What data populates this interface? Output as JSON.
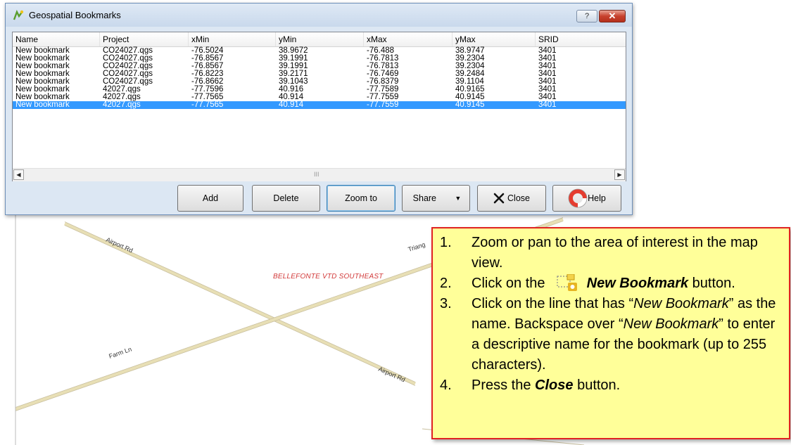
{
  "window": {
    "title": "Geospatial Bookmarks",
    "help_button": "?",
    "close_button": "✕"
  },
  "table": {
    "columns": [
      "Name",
      "Project",
      "xMin",
      "yMin",
      "xMax",
      "yMax",
      "SRID"
    ],
    "rows": [
      [
        "New bookmark",
        "CO24027.qgs",
        "-76.5024",
        "38.9672",
        "-76.488",
        "38.9747",
        "3401"
      ],
      [
        "New bookmark",
        "CO24027.qgs",
        "-76.8567",
        "39.1991",
        "-76.7813",
        "39.2304",
        "3401"
      ],
      [
        "New bookmark",
        "CO24027.qgs",
        "-76.8567",
        "39.1991",
        "-76.7813",
        "39.2304",
        "3401"
      ],
      [
        "New bookmark",
        "CO24027.qgs",
        "-76.8223",
        "39.2171",
        "-76.7469",
        "39.2484",
        "3401"
      ],
      [
        "New bookmark",
        "CO24027.qgs",
        "-76.8662",
        "39.1043",
        "-76.8379",
        "39.1104",
        "3401"
      ],
      [
        "New bookmark",
        "42027.qgs",
        "-77.7596",
        "40.916",
        "-77.7589",
        "40.9165",
        "3401"
      ],
      [
        "New bookmark",
        "42027.qgs",
        "-77.7565",
        "40.914",
        "-77.7559",
        "40.9145",
        "3401"
      ],
      [
        "New bookmark",
        "42027.qgs",
        "-77.7565",
        "40.914",
        "-77.7559",
        "40.9145",
        "3401"
      ]
    ],
    "selected_row": 7,
    "scroll_grip": "III"
  },
  "buttons": {
    "add": "Add",
    "delete": "Delete",
    "zoom_to": "Zoom to",
    "share": "Share",
    "close": "Close",
    "help": "Help"
  },
  "icons": {
    "title": "bookmark-star-icon",
    "close": "x-mark-icon",
    "help": "lifebuoy-icon",
    "share_arrow": "dropdown-arrow-icon",
    "new_bookmark": "new-bookmark-icon"
  },
  "colors": {
    "selection": "#3399ff",
    "callout_bg": "#ffff99",
    "callout_border": "#e02222",
    "district_label": "#d23a3a"
  },
  "map": {
    "road_labels": {
      "airport_rd_top": "Airport Rd",
      "triangle": "Triang",
      "farm_ln": "Farm Ln",
      "airport_rd_bottom": "Airport Rd"
    },
    "district_label": "BELLEFONTE VTD SOUTHEAST"
  },
  "callout": {
    "step1_num": "1.",
    "step1_text": "Zoom or pan to the area of interest in the map view.",
    "step2_num": "2.",
    "step2_prefix": "Click on the",
    "step2_bold": "New Bookmark",
    "step2_suffix": " button.",
    "step3_num": "3.",
    "step3_a": "Click on the line that has “",
    "step3_b": "New Bookmark",
    "step3_c": "” as the name. Backspace over “",
    "step3_d": "New Bookmark",
    "step3_e": "” to enter a descriptive name for the bookmark (up to 255 characters).",
    "step4_num": "4.",
    "step4_prefix": "Press the ",
    "step4_bold": "Close",
    "step4_suffix": " button."
  }
}
